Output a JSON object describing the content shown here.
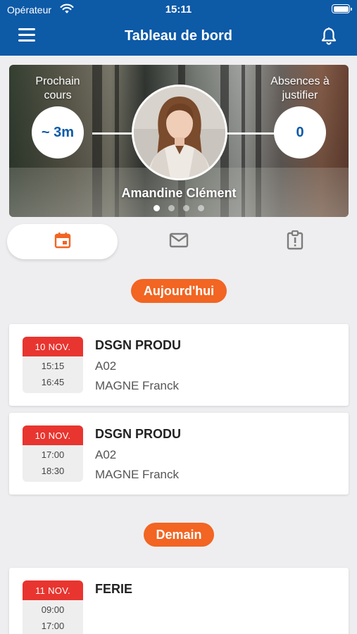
{
  "status_bar": {
    "carrier": "Opérateur",
    "time": "15:11"
  },
  "nav": {
    "title": "Tableau de bord",
    "menu_icon": "hamburger-menu-icon",
    "bell_icon": "bell-icon"
  },
  "hero": {
    "next_course_label": "Prochain cours",
    "next_course_value": "~ 3m",
    "absences_label": "Absences à justifier",
    "absences_value": "0",
    "student_name": "Amandine Clément",
    "pages": 4,
    "active_page": 1
  },
  "tabs": [
    {
      "icon": "calendar-icon",
      "active": true
    },
    {
      "icon": "mail-icon",
      "active": false
    },
    {
      "icon": "clipboard-alert-icon",
      "active": false
    }
  ],
  "sections": [
    {
      "label": "Aujourd'hui",
      "courses": [
        {
          "date": "10 NOV.",
          "start": "15:15",
          "end": "16:45",
          "title": "DSGN PRODU",
          "room": "A02",
          "teacher": "MAGNE Franck"
        },
        {
          "date": "10 NOV.",
          "start": "17:00",
          "end": "18:30",
          "title": "DSGN PRODU",
          "room": "A02",
          "teacher": "MAGNE Franck"
        }
      ]
    },
    {
      "label": "Demain",
      "courses": [
        {
          "date": "11 NOV.",
          "start": "09:00",
          "end": "17:00",
          "title": "FERIE"
        }
      ]
    }
  ],
  "colors": {
    "primary": "#0d5aa7",
    "accent": "#f26522",
    "date_header": "#e8352f",
    "background": "#eeeef0"
  }
}
